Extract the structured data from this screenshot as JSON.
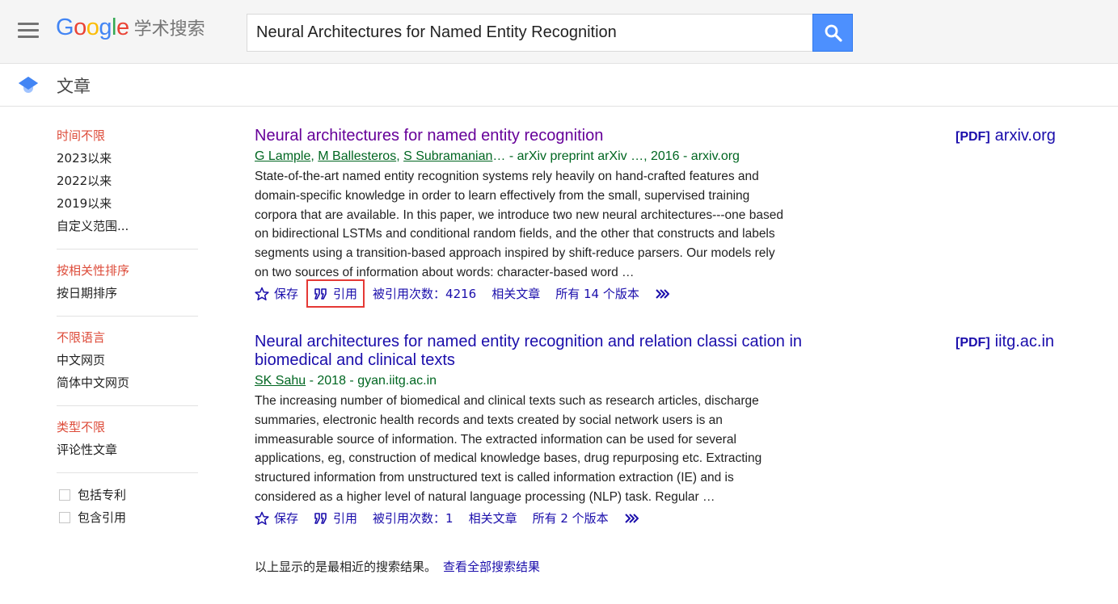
{
  "header": {
    "logo_letters": [
      "G",
      "o",
      "o",
      "g",
      "l",
      "e"
    ],
    "logo_colors": [
      "#4285f4",
      "#ea4335",
      "#fbbc05",
      "#4285f4",
      "#34a853",
      "#ea4335"
    ],
    "product_name": "学术搜索",
    "search_query": "Neural Architectures for Named Entity Recognition",
    "search_button_icon": "search-icon",
    "menu_icon": "hamburger-menu-icon"
  },
  "subheader": {
    "icon": "graduation-cap-icon",
    "title": "文章"
  },
  "sidebar": {
    "time": [
      "时间不限",
      "2023以来",
      "2022以来",
      "2019以来",
      "自定义范围..."
    ],
    "sort": [
      "按相关性排序",
      "按日期排序"
    ],
    "language": [
      "不限语言",
      "中文网页",
      "简体中文网页"
    ],
    "type": [
      "类型不限",
      "评论性文章"
    ],
    "checkboxes": [
      "包括专利",
      "包含引用"
    ]
  },
  "results": [
    {
      "title": "Neural architectures for named entity recognition",
      "authors": [
        "G Lample",
        "M Ballesteros",
        "S Subramanian"
      ],
      "meta_rest": "… - arXiv preprint arXiv …, 2016 - arxiv.org",
      "snippet": "State-of-the-art named entity recognition systems rely heavily on hand-crafted features and domain-specific knowledge in order to learn effectively from the small, supervised training corpora that are available. In this paper, we introduce two new neural architectures---one based on bidirectional LSTMs and conditional random fields, and the other that constructs and labels segments using a transition-based approach inspired by shift-reduce parsers. Our models rely on two sources of information about words: character-based word …",
      "save": "保存",
      "cite": "引用",
      "cited_by": "被引用次数：4216",
      "related": "相关文章",
      "versions": "所有 14 个版本",
      "pdf_tag": "[PDF]",
      "pdf_source": "arxiv.org"
    },
    {
      "title": "Neural architectures for named entity recognition and relation classi cation in biomedical and clinical texts",
      "authors": [
        "SK Sahu"
      ],
      "meta_rest": " - 2018 - gyan.iitg.ac.in",
      "snippet": "The increasing number of biomedical and clinical texts such as research articles, discharge summaries, electronic health records and texts created by social network users is an immeasurable source of information. The extracted information can be used for several applications, eg, construction of medical knowledge bases, drug repurposing etc. Extracting structured information from unstructured text is called information extraction (IE) and is considered as a higher level of natural language processing (NLP) task. Regular …",
      "save": "保存",
      "cite": "引用",
      "cited_by": "被引用次数：1",
      "related": "相关文章",
      "versions": "所有 2 个版本",
      "pdf_tag": "[PDF]",
      "pdf_source": "iitg.ac.in"
    }
  ],
  "footer": {
    "note": "以上显示的是最相近的搜索结果。",
    "link": "查看全部搜索结果"
  },
  "colors": {
    "link": "#1a0dab",
    "visited": "#660099",
    "meta_green": "#006621",
    "selected_red": "#dd4b39",
    "search_blue": "#4d90fe",
    "cite_highlight": "#e53935"
  }
}
